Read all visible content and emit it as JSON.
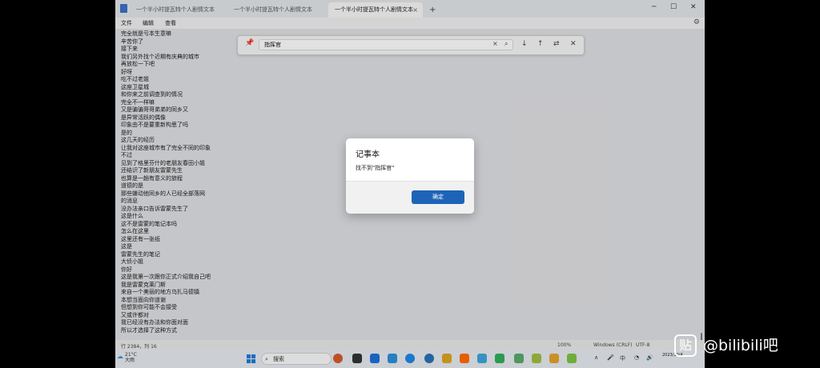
{
  "tabs": [
    {
      "label": "一个半小时提瓦特个人剧情文本"
    },
    {
      "label": "一个半小时提瓦特个人剧情文本"
    },
    {
      "label": "一个半小时提瓦特个人剧情文本",
      "active": true
    }
  ],
  "tab_close_glyph": "×",
  "new_tab_glyph": "+",
  "window_controls": {
    "minimize": "─",
    "maximize": "☐",
    "close": "✕"
  },
  "menu": {
    "file": "文件",
    "edit": "编辑",
    "view": "查看"
  },
  "settings_glyph": "⚙",
  "editor_lines": [
    "完全就是亏本生意嘛",
    "辛苦你了",
    "接下来",
    "我们另外找个近期有庆典的城市",
    "再放松一下吧",
    "好呀",
    "吃不过老姐",
    "这座卫星城",
    "和你来之前调查到的情况",
    "完全不一样嘛",
    "又是骗骗哥哥弟弟的同乡又",
    "是异常活跃的偶像",
    "印象由不是要重新构思了吗",
    "是的",
    "这几天的经历",
    "让我对这座城市有了完全不同的印象",
    "不过",
    "见到了格里芬什的老朋友春田小姐",
    "还结识了新朋友雷蒙先生",
    "也算是一趟有意义的旅程",
    "道德的是",
    "那些嫌动他同乡的人已经全部落网",
    "的消息",
    "没办法亲口告诉雷蒙先生了",
    "这是什么",
    "这不是雷蒙的笔记本吗",
    "怎么在这里",
    "这里还有一张纸",
    "这是",
    "雷蒙先生的笔记",
    "大侦小姐",
    "你好",
    "这是我第一次跟你正式介绍我自己吧",
    "我是雷蒙克莱门斯",
    "来自一个美丽的地方乌扎马德镇",
    "本想当面向你道谢",
    "但想到你可能不会接受",
    "又或许都对",
    "我已经没有办法和你面对面",
    "所以才选择了这种方式"
  ],
  "find": {
    "value": "指挥官"
  },
  "status": {
    "position": "行 2384，列 16",
    "zoom": "100%",
    "line_ending": "Windows (CRLF)",
    "encoding": "UTF-8"
  },
  "dialog": {
    "title": "记事本",
    "message": "找不到\"指挥官\"",
    "ok": "确定"
  },
  "taskbar": {
    "temp": "21°C",
    "condition": "大雨",
    "search_label": "搜索",
    "ime": "中",
    "date": "2023/10/4"
  },
  "watermark": {
    "badge": "贴",
    "text": "@bilibili吧"
  },
  "colors": {
    "accent": "#1d64b8",
    "start": "#1f7ad6"
  }
}
